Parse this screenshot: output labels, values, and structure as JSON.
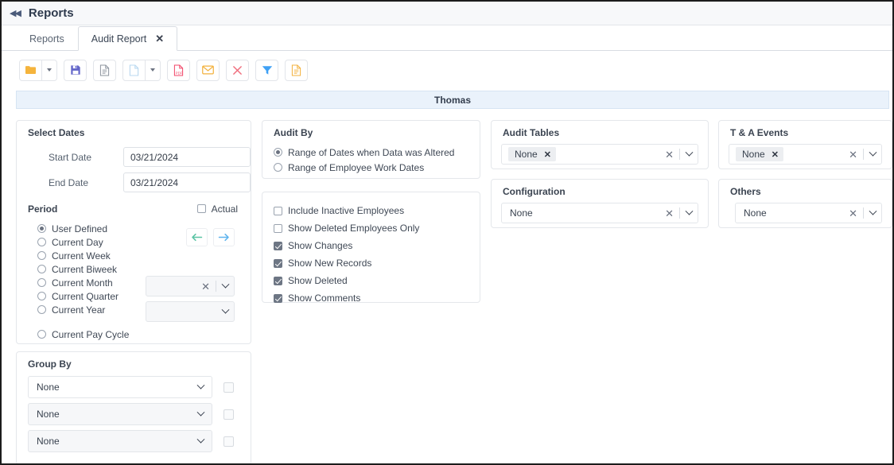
{
  "header": {
    "collapse_icon": "collapse-left-icon",
    "title": "Reports"
  },
  "tabs": [
    {
      "label": "Reports",
      "active": false,
      "closable": false
    },
    {
      "label": "Audit Report",
      "active": true,
      "closable": true,
      "close_glyph": "✕"
    }
  ],
  "toolbar": {
    "buttons": [
      {
        "name": "open-folder-button",
        "icon": "folder-icon",
        "color": "#f7b733"
      },
      {
        "name": "open-folder-dropdown",
        "icon": "caret-down-icon"
      },
      {
        "name": "save-button",
        "icon": "floppy-disk-icon",
        "color": "#6366c9"
      },
      {
        "name": "document-button",
        "icon": "document-icon",
        "color": "#8d949e"
      },
      {
        "name": "new-document-button",
        "icon": "blank-page-icon",
        "color": "#b9d8f0"
      },
      {
        "name": "new-document-dropdown",
        "icon": "caret-down-icon"
      },
      {
        "name": "export-pdf-button",
        "icon": "pdf-icon",
        "color": "#f14668"
      },
      {
        "name": "email-button",
        "icon": "envelope-icon",
        "color": "#f3b13c"
      },
      {
        "name": "delete-button",
        "icon": "close-x-icon",
        "color": "#f0707f"
      },
      {
        "name": "filter-button",
        "icon": "funnel-icon",
        "color": "#3fa1f5"
      },
      {
        "name": "report-button",
        "icon": "report-document-icon",
        "color": "#f3b13c"
      }
    ]
  },
  "banner": {
    "text": "Thomas"
  },
  "select_dates": {
    "title": "Select Dates",
    "start_date_label": "Start Date",
    "start_date_value": "03/21/2024",
    "end_date_label": "End Date",
    "end_date_value": "03/21/2024",
    "period_label": "Period",
    "actual_label": "Actual",
    "actual_checked": false,
    "periods": [
      {
        "label": "User Defined",
        "checked": true
      },
      {
        "label": "Current Day",
        "checked": false
      },
      {
        "label": "Current Week",
        "checked": false
      },
      {
        "label": "Current Biweek",
        "checked": false
      },
      {
        "label": "Current Month",
        "checked": false
      },
      {
        "label": "Current Quarter",
        "checked": false
      },
      {
        "label": "Current Year",
        "checked": false
      }
    ],
    "pay_cycle": {
      "label": "Current Pay Cycle",
      "checked": false,
      "value": ""
    },
    "period_select_value": "",
    "prev_arrow": "arrow-left-icon",
    "next_arrow": "arrow-right-icon"
  },
  "audit_by": {
    "title": "Audit By",
    "options": [
      {
        "label": "Range of Dates when Data was Altered",
        "checked": true
      },
      {
        "label": "Range of Employee Work Dates",
        "checked": false
      }
    ]
  },
  "options": {
    "items": [
      {
        "label": "Include Inactive Employees",
        "checked": false
      },
      {
        "label": "Show Deleted Employees Only",
        "checked": false
      },
      {
        "label": "Show Changes",
        "checked": true
      },
      {
        "label": "Show New Records",
        "checked": true
      },
      {
        "label": "Show Deleted",
        "checked": true
      },
      {
        "label": "Show Comments",
        "checked": true
      }
    ]
  },
  "audit_tables": {
    "title": "Audit Tables",
    "chip": "None"
  },
  "ta_events": {
    "title": "T & A Events",
    "chip": "None"
  },
  "configuration": {
    "title": "Configuration",
    "value": "None"
  },
  "others": {
    "title": "Others",
    "value": "None"
  },
  "group_by": {
    "title": "Group By",
    "rows": [
      {
        "value": "None",
        "checked": false
      },
      {
        "value": "None",
        "checked": false
      },
      {
        "value": "None",
        "checked": false
      }
    ]
  }
}
